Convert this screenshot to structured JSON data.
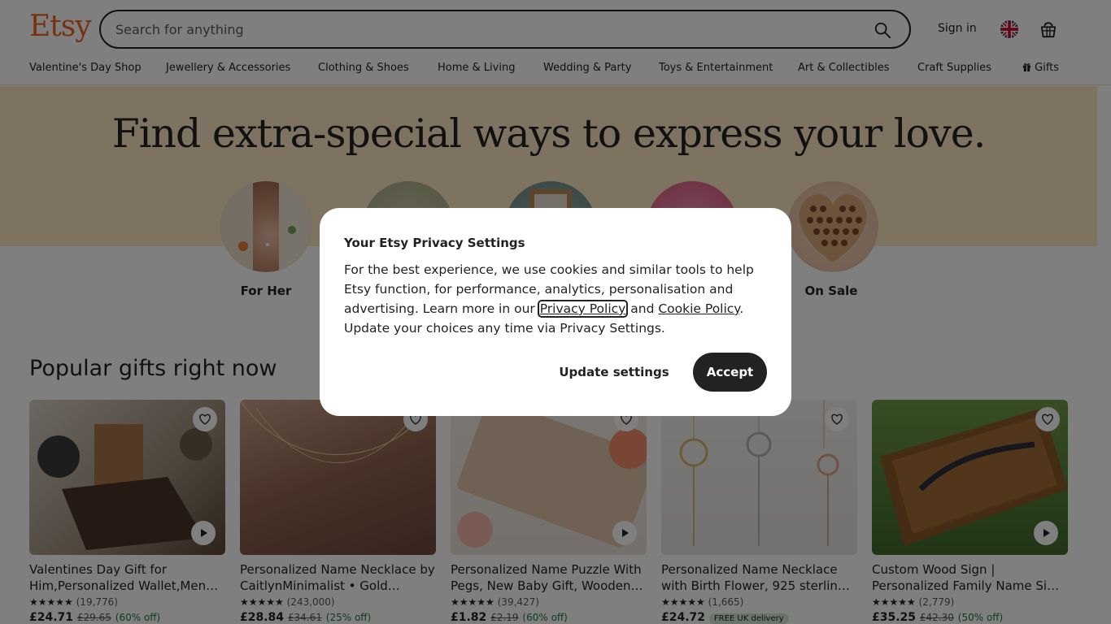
{
  "header": {
    "logo": "Etsy",
    "search_placeholder": "Search for anything",
    "sign_in": "Sign in"
  },
  "nav": {
    "categories": [
      "Valentine's Day Shop",
      "Jewellery & Accessories",
      "Clothing & Shoes",
      "Home & Living",
      "Wedding & Party",
      "Toys & Entertainment",
      "Art & Collectibles",
      "Craft Supplies",
      "Gifts"
    ]
  },
  "hero": {
    "title": "Find extra-special ways to express your love.",
    "circles": [
      "For Her",
      "",
      "",
      "",
      "On Sale"
    ]
  },
  "popular": {
    "title": "Popular gifts right now",
    "items": [
      {
        "title": "Valentines Day Gift for Him,Personalized Wallet,Men…",
        "stars": "★★★★★",
        "reviews": "(19,776)",
        "price": "£24.71",
        "old_price": "£29.65",
        "discount": "(60% off)"
      },
      {
        "title": "Personalized Name Necklace by CaitlynMinimalist • Gold…",
        "stars": "★★★★★",
        "reviews": "(243,000)",
        "price": "£28.84",
        "old_price": "£34.61",
        "discount": "(25% off)"
      },
      {
        "title": "Personalized Name Puzzle With Pegs, New Baby Gift, Wooden…",
        "stars": "★★★★★",
        "reviews": "(39,427)",
        "price": "£1.82",
        "old_price": "£2.19",
        "discount": "(60% off)"
      },
      {
        "title": "Personalized Name Necklace with Birth Flower, 925 sterlin…",
        "stars": "★★★★★",
        "reviews": "(1,665)",
        "price": "£24.72",
        "badge": "FREE UK delivery"
      },
      {
        "title": "Custom Wood Sign | Personalized Family Name Si…",
        "stars": "★★★★★",
        "reviews": "(2,779)",
        "price": "£35.25",
        "old_price": "£42.30",
        "discount": "(50% off)"
      }
    ]
  },
  "modal": {
    "title": "Your Etsy Privacy Settings",
    "body_1": "For the best experience, we use cookies and similar tools to help Etsy function, for performance, analytics, personalisation and advertising. Learn more in our ",
    "privacy_link": "Privacy Policy",
    "body_2": " and ",
    "cookie_link": "Cookie Policy",
    "body_3": ". Update your choices any time via Privacy Settings.",
    "update_button": "Update settings",
    "accept_button": "Accept"
  },
  "colors": {
    "brand": "#f1641e",
    "hero_bg": "#fde6c2",
    "dark_button": "#222222"
  }
}
